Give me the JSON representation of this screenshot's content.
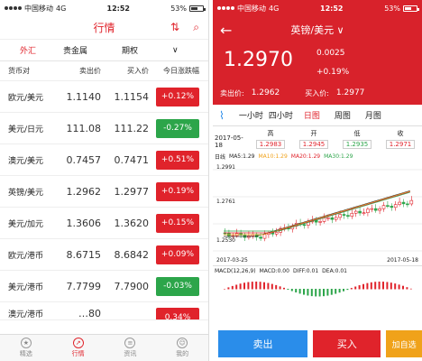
{
  "left": {
    "status": {
      "carrier": "中国移动",
      "network": "4G",
      "time": "12:52",
      "battery": "53%"
    },
    "header": {
      "title": "行情"
    },
    "tabs": [
      "外汇",
      "贵金属",
      "期权"
    ],
    "columns": [
      "货币对",
      "卖出价",
      "买入价",
      "今日涨跌幅"
    ],
    "rows": [
      {
        "pair": "欧元/美元",
        "sell": "1.1140",
        "buy": "1.1154",
        "change": "+0.12%",
        "dir": "up"
      },
      {
        "pair": "美元/日元",
        "sell": "111.08",
        "buy": "111.22",
        "change": "-0.27%",
        "dir": "dn"
      },
      {
        "pair": "澳元/美元",
        "sell": "0.7457",
        "buy": "0.7471",
        "change": "+0.51%",
        "dir": "up"
      },
      {
        "pair": "英镑/美元",
        "sell": "1.2962",
        "buy": "1.2977",
        "change": "+0.19%",
        "dir": "up"
      },
      {
        "pair": "美元/加元",
        "sell": "1.3606",
        "buy": "1.3620",
        "change": "+0.15%",
        "dir": "up"
      },
      {
        "pair": "欧元/港币",
        "sell": "8.6715",
        "buy": "8.6842",
        "change": "+0.09%",
        "dir": "up"
      },
      {
        "pair": "美元/港币",
        "sell": "7.7799",
        "buy": "7.7900",
        "change": "-0.03%",
        "dir": "dn"
      }
    ],
    "partial_row": {
      "pair": "澳元/港币",
      "sell": "…80",
      "change": "0.34%"
    },
    "bottom": [
      {
        "label": "精选",
        "icon": "star-icon"
      },
      {
        "label": "行情",
        "icon": "chart-icon",
        "active": true
      },
      {
        "label": "资讯",
        "icon": "news-icon"
      },
      {
        "label": "我的",
        "icon": "person-icon"
      }
    ]
  },
  "right": {
    "status": {
      "carrier": "中国移动",
      "network": "4G",
      "time": "12:52",
      "battery": "53%"
    },
    "header": {
      "title": "英镑/美元 ∨"
    },
    "price": "1.2970",
    "change": "0.0025",
    "change_pct": "+0.19%",
    "sell_label": "卖出价:",
    "sell": "1.2962",
    "buy_label": "买入价:",
    "buy": "1.2977",
    "tabs": [
      "一小时",
      "四小时",
      "日图",
      "周图",
      "月图"
    ],
    "active_tab": "日图",
    "ohlc": {
      "date": "2017-05-18",
      "high_label": "高",
      "high": "1.2983",
      "open_label": "开",
      "open": "1.2945",
      "low_label": "低",
      "low": "1.2935",
      "close_label": "收",
      "close": "1.2971"
    },
    "ma": {
      "label": "日线",
      "ma5": "MA5:1.29",
      "ma10": "MA10:1.29",
      "ma20": "MA20:1.29",
      "ma30": "MA30:1.29"
    },
    "axis": {
      "top": "1.2991",
      "mid": "1.2761",
      "low": "1.2530",
      "start_date": "2017-03-25",
      "end_date": "2017-05-18"
    },
    "macd": {
      "label": "MACD(12,26,9)",
      "macd": "MACD:0.00",
      "diff": "DIFF:0.01",
      "dea": "DEA:0.01"
    },
    "actions": {
      "sell": "卖出",
      "buy": "买入",
      "watch": "加自选"
    },
    "colors": {
      "red": "#e0232b",
      "green": "#2ca54a",
      "orange": "#f0a21a",
      "blue": "#2a8dea"
    }
  }
}
